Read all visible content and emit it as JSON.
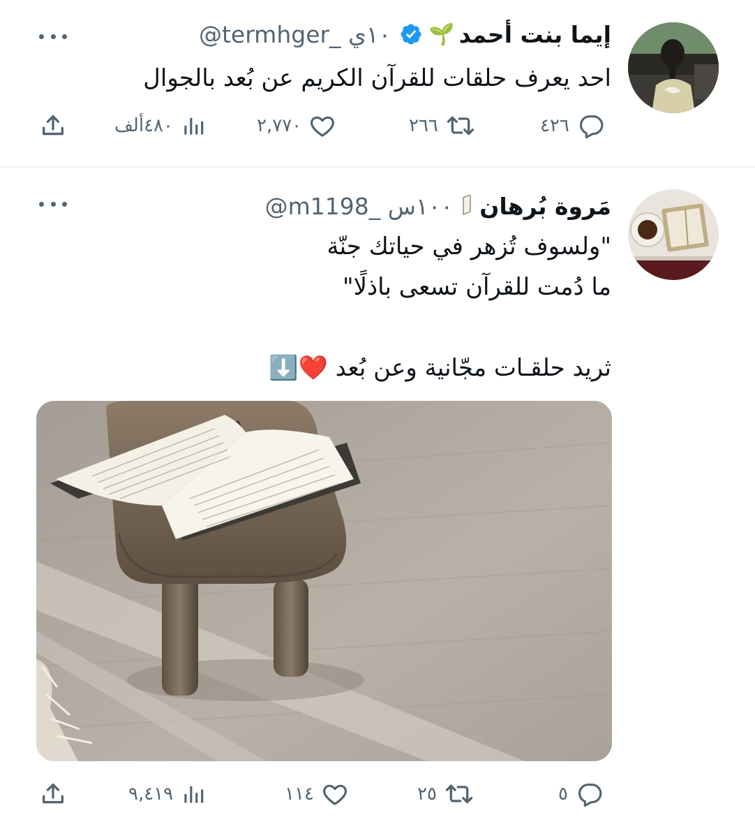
{
  "tweets": [
    {
      "name": "إيما بنت أحمد",
      "emoji": "🌱",
      "verified": true,
      "handle_time": "@termhger_ ١٠ي",
      "text": "احد يعرف حلقات للقرآن الكريم عن بُعد بالجوال",
      "stats": {
        "replies": "٤٢٦",
        "retweets": "٢٦٦",
        "likes": "٢,٧٧٠",
        "views": "٤٨٠ألف"
      }
    },
    {
      "name": "مَروة بُرهان",
      "emoji": "",
      "verified": false,
      "handle_time": "@m1198_ ١٠٠س",
      "text": "\"ولسوف تُزهر في حياتك جنّة\nما دُمت للقرآن تسعى باذلًا\"\n\nثريد حلقـات مجّانية وعن بُعد ❤️⬇️",
      "stats": {
        "replies": "٥",
        "retweets": "٢٥",
        "likes": "١١٤",
        "views": "٩,٤١٩"
      }
    }
  ],
  "colors": {
    "text": "#0f1419",
    "secondary": "#536471",
    "verified": "#1d9bf0",
    "divider": "#eff3f4"
  },
  "icons": [
    "reply-icon",
    "retweet-icon",
    "like-icon",
    "views-icon",
    "share-icon",
    "more-icon",
    "verified-badge-icon"
  ]
}
